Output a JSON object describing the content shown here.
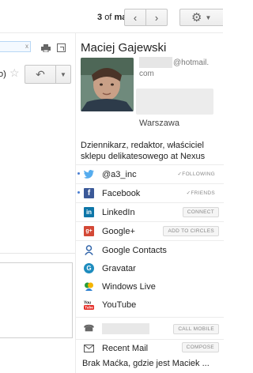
{
  "toolbar": {
    "pager_index": "3",
    "pager_of": "of",
    "pager_total": "many",
    "prev_icon": "chevron-left-icon",
    "next_icon": "chevron-right-icon",
    "settings_icon": "gear-icon"
  },
  "message": {
    "truncated_text": "o)",
    "image_chip_x": "x"
  },
  "contact": {
    "name": "Maciej Gajewski",
    "email_domain": "@hotmail.",
    "email_tld": "com",
    "location": "Warszawa",
    "bio": "Dziennikarz, redaktor, właściciel sklepu delikatesowego at Nexus"
  },
  "services": [
    {
      "icon": "twitter-icon",
      "label": "@a3_inc",
      "action": "✓FOLLOWING"
    },
    {
      "icon": "facebook-icon",
      "label": "Facebook",
      "action": "✓FRIENDS"
    },
    {
      "icon": "linkedin-icon",
      "label": "LinkedIn",
      "action": "CONNECT"
    },
    {
      "icon": "google-plus-icon",
      "label": "Google+",
      "action": "ADD TO CIRCLES"
    },
    {
      "icon": "google-contacts-icon",
      "label": "Google Contacts",
      "action": ""
    },
    {
      "icon": "gravatar-icon",
      "label": "Gravatar",
      "action": ""
    },
    {
      "icon": "windows-live-icon",
      "label": "Windows Live",
      "action": ""
    },
    {
      "icon": "youtube-icon",
      "label": "YouTube",
      "action": ""
    }
  ],
  "phone": {
    "action": "CALL MOBILE"
  },
  "recent_mail": {
    "label": "Recent Mail",
    "action": "COMPOSE",
    "subject": "Brak Maćka, gdzie jest Maciek ..."
  },
  "colors": {
    "facebook": "#3b5998",
    "linkedin": "#0e76a8",
    "google_plus": "#d34836",
    "twitter": "#55acee",
    "youtube": "#e52d27"
  }
}
